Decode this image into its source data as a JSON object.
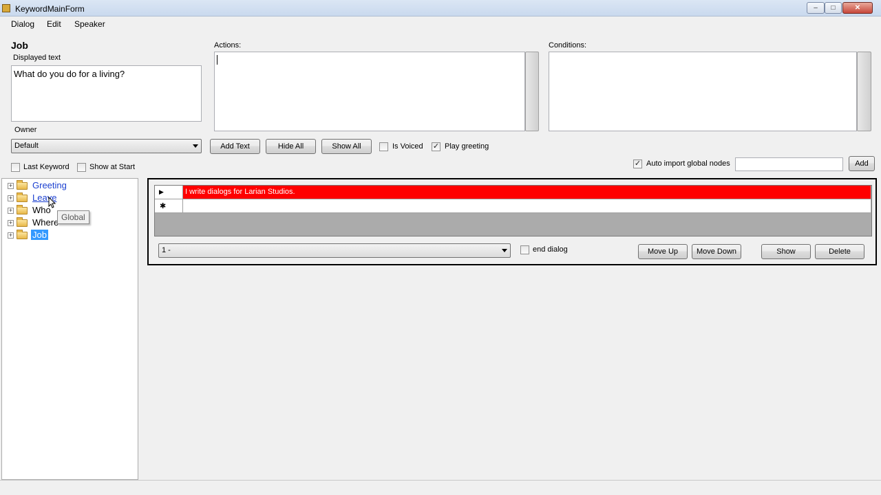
{
  "window": {
    "title": "KeywordMainForm",
    "minimize": "–",
    "maximize": "□",
    "close": "✕"
  },
  "menu": [
    "Dialog",
    "Edit",
    "Speaker"
  ],
  "job": {
    "title": "Job",
    "displayed_text_label": "Displayed text",
    "displayed_text": "What do you do for a living?",
    "owner_label": "Owner",
    "owner_value": "Default",
    "last_keyword_label": "Last Keyword",
    "show_at_start_label": "Show at Start"
  },
  "actions": {
    "label": "Actions:"
  },
  "conditions": {
    "label": "Conditions:"
  },
  "toolbar": {
    "add_text": "Add Text",
    "hide_all": "Hide All",
    "show_all": "Show All",
    "is_voiced": "Is Voiced",
    "is_voiced_checked": false,
    "play_greeting": "Play greeting",
    "play_greeting_checked": true,
    "auto_import": "Auto import global nodes",
    "auto_import_checked": true,
    "add": "Add"
  },
  "tree": {
    "nodes": [
      {
        "label": "Greeting",
        "style": "link"
      },
      {
        "label": "Leave",
        "style": "link"
      },
      {
        "label": "Who",
        "style": "plain"
      },
      {
        "label": "Where",
        "style": "plain"
      },
      {
        "label": "Job",
        "style": "selected"
      }
    ],
    "tooltip": "Global"
  },
  "dialog_panel": {
    "rows": [
      {
        "marker": "▶",
        "text": "I write dialogs for Larian Studios.",
        "highlight": "#ff0000"
      },
      {
        "marker": "✱",
        "text": ""
      }
    ],
    "selector_value": "1 -",
    "end_dialog": "end dialog",
    "move_up": "Move Up",
    "move_down": "Move Down",
    "show": "Show",
    "delete": "Delete"
  }
}
